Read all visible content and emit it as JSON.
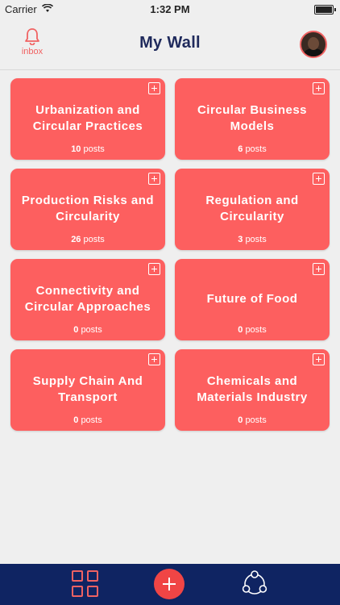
{
  "status": {
    "carrier": "Carrier",
    "time": "1:32 PM"
  },
  "header": {
    "inbox_label": "inbox",
    "title": "My Wall"
  },
  "cards": [
    {
      "title": "Urbanization and Circular Practices",
      "count": "10",
      "suffix": "posts"
    },
    {
      "title": "Circular Business Models",
      "count": "6",
      "suffix": "posts"
    },
    {
      "title": "Production Risks and Circularity",
      "count": "26",
      "suffix": "posts"
    },
    {
      "title": "Regulation and Circularity",
      "count": "3",
      "suffix": "posts"
    },
    {
      "title": "Connectivity and Circular Approaches",
      "count": "0",
      "suffix": "posts"
    },
    {
      "title": "Future of Food",
      "count": "0",
      "suffix": "posts"
    },
    {
      "title": "Supply Chain And Transport",
      "count": "0",
      "suffix": "posts"
    },
    {
      "title": "Chemicals and Materials Industry",
      "count": "0",
      "suffix": "posts"
    }
  ],
  "colors": {
    "accent": "#fd5f5f",
    "navy": "#0f2462",
    "title": "#1f2a5c"
  },
  "icons": {
    "inbox": "bell-icon",
    "card_action": "add-square-icon",
    "tab_1": "grid-icon",
    "tab_2": "add-circle-icon",
    "tab_3": "network-icon"
  }
}
